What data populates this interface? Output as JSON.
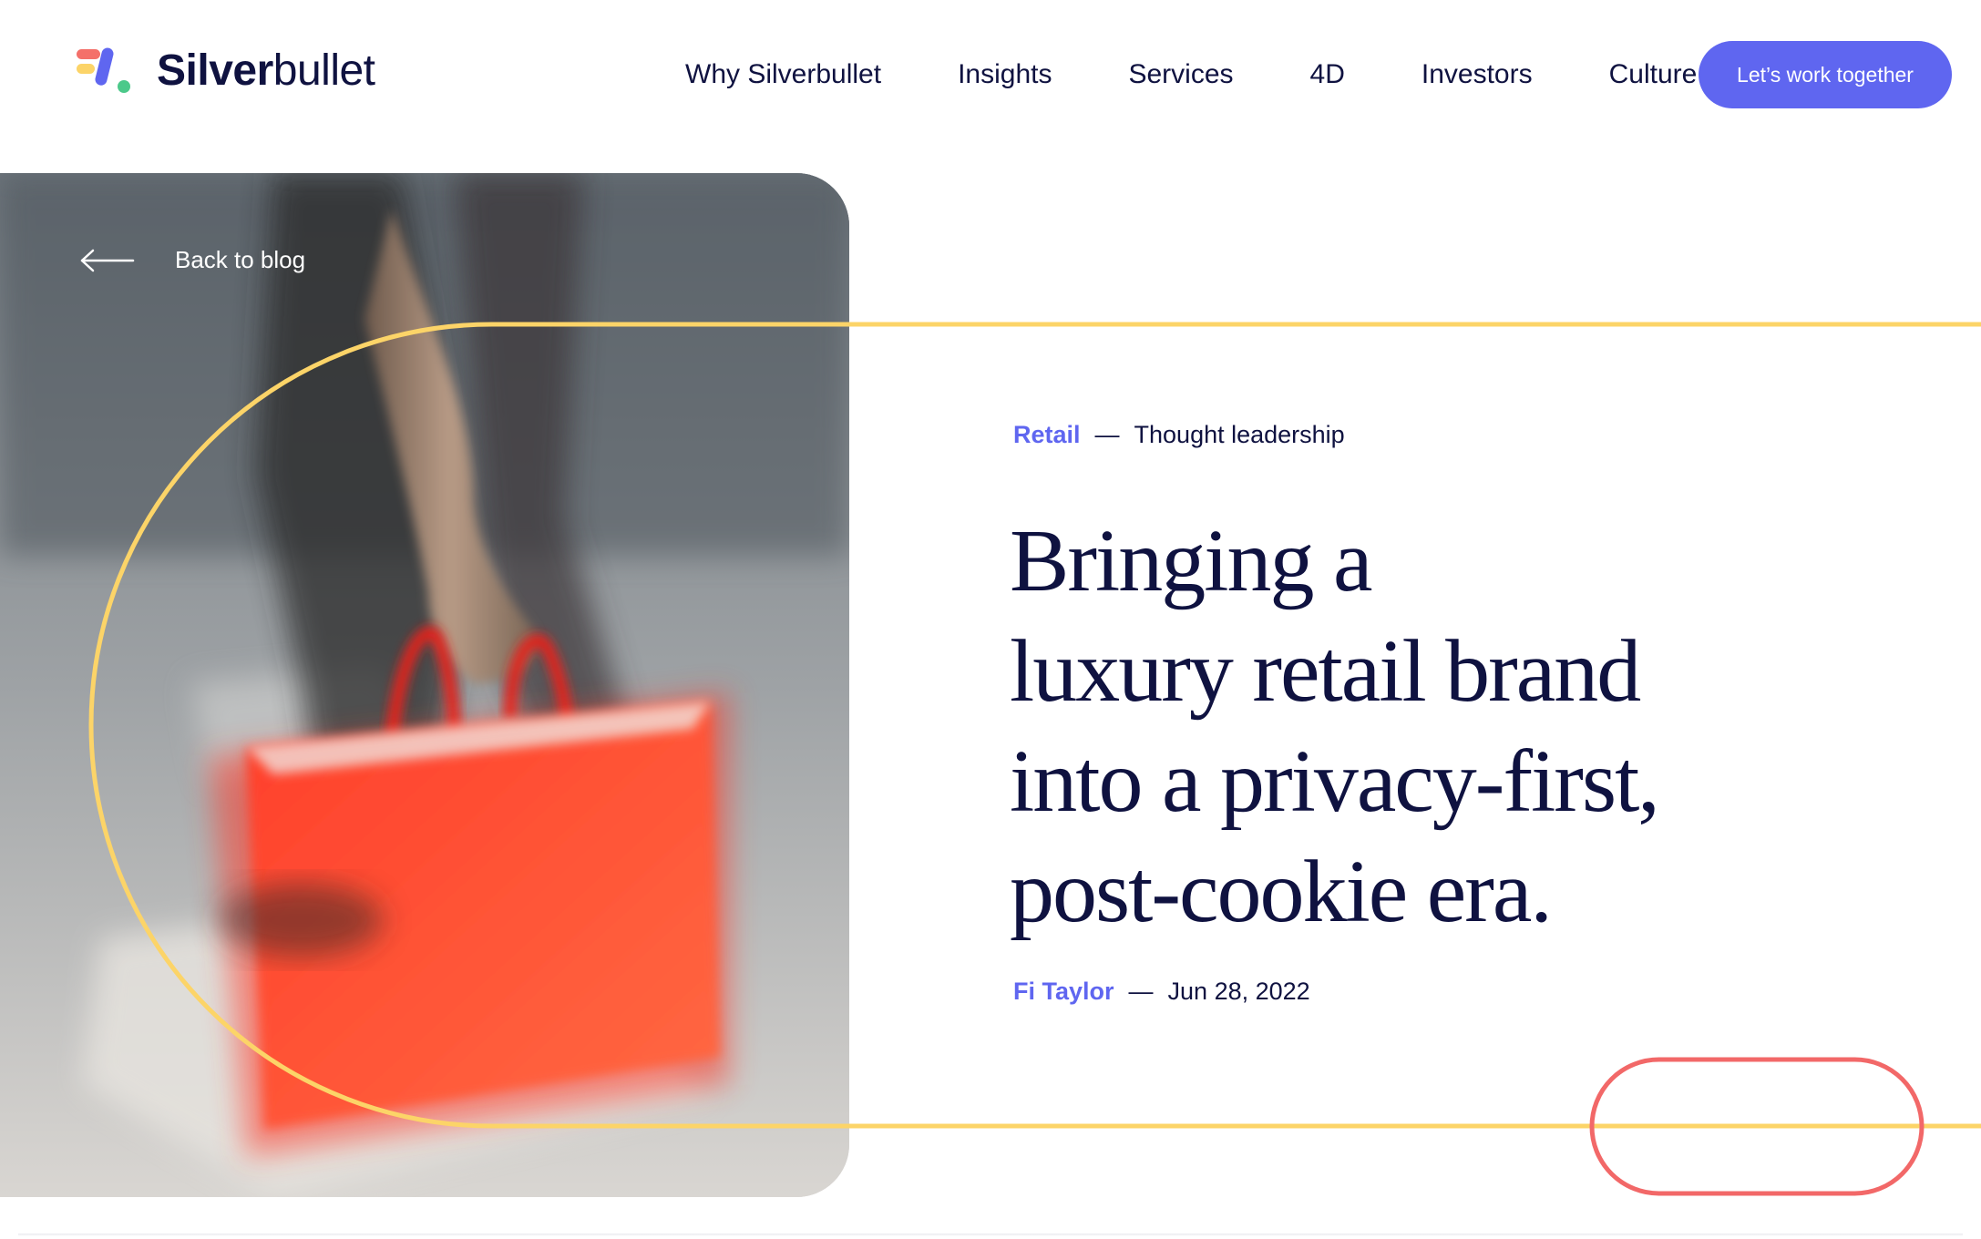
{
  "header": {
    "logo": {
      "brand_bold": "Silver",
      "brand_light": "bullet"
    },
    "nav": [
      {
        "label": "Why Silverbullet"
      },
      {
        "label": "Insights"
      },
      {
        "label": "Services"
      },
      {
        "label": "4D"
      },
      {
        "label": "Investors"
      },
      {
        "label": "Culture"
      }
    ],
    "cta_label": "Let’s work together"
  },
  "hero": {
    "back_label": "Back to blog",
    "category": "Retail",
    "separator": "—",
    "subcategory": "Thought leadership",
    "headline_lines": [
      "Bringing a",
      "luxury retail brand",
      "into a privacy-first,",
      "post-cookie era."
    ],
    "author": "Fi Taylor",
    "date": "Jun 28, 2022"
  },
  "colors": {
    "accent": "#5f66f0",
    "navy": "#0f1240",
    "yellow": "#fcd468",
    "coral": "#f26868",
    "bag": "#ff5a36"
  },
  "icons": {
    "back": "arrow-left-icon",
    "logo": "silverbullet-logo-mark"
  }
}
